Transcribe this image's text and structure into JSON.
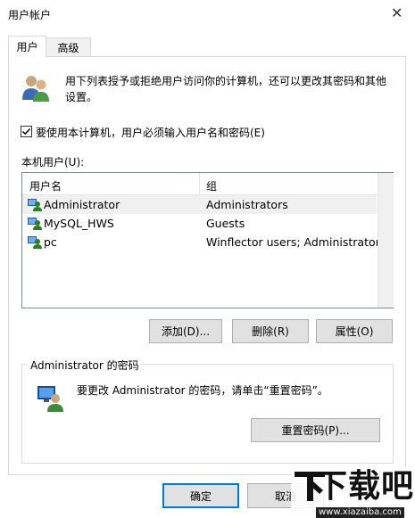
{
  "window": {
    "title": "用户帐户",
    "close_glyph": "✕"
  },
  "tabs": [
    {
      "label": "用户",
      "active": true
    },
    {
      "label": "高级",
      "active": false
    }
  ],
  "intro_text_1": "用下列表授予或拒绝用户访问你的计算机，还可以更改其密码和其他",
  "intro_text_2": "设置。",
  "require_login_label": "要使用本计算机，用户必须输入用户名和密码(E)",
  "require_login_checked": true,
  "users_label": "本机用户(U):",
  "table": {
    "headers": [
      "用户名",
      "组"
    ],
    "rows": [
      {
        "name": "Administrator",
        "group": "Administrators",
        "selected": true
      },
      {
        "name": "MySQL_HWS",
        "group": "Guests",
        "selected": false
      },
      {
        "name": "pc",
        "group": "Winflector users; Administrators",
        "selected": false
      }
    ]
  },
  "buttons": {
    "add": "添加(D)...",
    "remove": "删除(R)",
    "properties": "属性(O)",
    "reset_password": "重置密码(P)...",
    "ok": "确定",
    "cancel": "取消"
  },
  "password_group": {
    "title": "Administrator 的密码",
    "text": "要更改 Administrator 的密码，请单击“重置密码”。"
  },
  "watermark": {
    "logo_text": "下载吧",
    "url": "www.xiazaiba.com"
  },
  "colors": {
    "accent": "#0078d7",
    "selected_row": "#f0f0f0",
    "panel_border": "#d9d9d9"
  }
}
